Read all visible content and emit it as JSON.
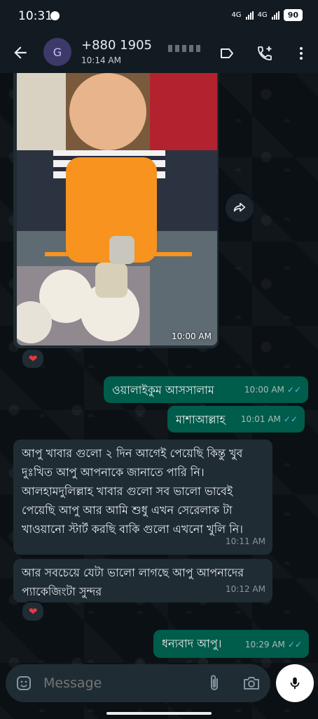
{
  "status_bar": {
    "time": "10:31",
    "network": "4G",
    "network2": "4G",
    "battery": "90"
  },
  "header": {
    "avatar_letter": "G",
    "contact_name": "+880 1905",
    "last_seen": "10:14 AM"
  },
  "image_message": {
    "time": "10:00 AM",
    "reaction": "❤"
  },
  "messages": [
    {
      "text": "ওয়ালাইকুম আসসালাম",
      "time": "10:00 AM",
      "ticks": "✓✓"
    },
    {
      "text": "মাশাআল্লাহ",
      "time": "10:01 AM",
      "ticks": "✓✓"
    },
    {
      "text": "আপু খাবার গুলো ২ দিন আগেই পেয়েছি কিন্তু খুব দুঃখিত আপু আপনাকে জানাতে পারি নি। আলহামদুলিল্লাহ খাবার গুলো সব ভালো ভাবেই পেয়েছি আপু আর আমি শুধু এখন সেরেলাক টা খাওয়ানো স্টার্ট করছি বাকি গুলো এখনো খুলি নি।",
      "time": "10:11 AM"
    },
    {
      "text": "আর সবচেয়ে যেটা ভালো লাগছে আপু আপনাদের প্যাকেজিংটা সুন্দর",
      "time": "10:12 AM",
      "reaction": "❤"
    },
    {
      "text": "ধন্যবাদ আপু।",
      "time": "10:29 AM",
      "ticks": "✓✓"
    }
  ],
  "composer": {
    "placeholder": "Message"
  },
  "icons": [
    "back-arrow-icon",
    "label-icon",
    "add-call-icon",
    "more-vert-icon",
    "forward-icon",
    "emoji-icon",
    "attach-icon",
    "camera-icon",
    "mic-icon"
  ],
  "colors": {
    "outgoing_bubble": "#005c4b",
    "incoming_bubble": "#1f2c34",
    "read_ticks": "#53bdeb",
    "header": "#121b22"
  }
}
